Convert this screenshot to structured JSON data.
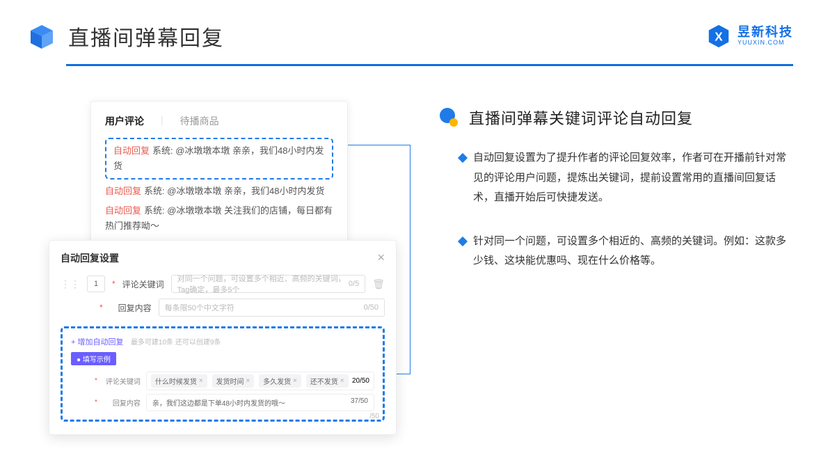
{
  "header": {
    "title": "直播间弹幕回复"
  },
  "brand": {
    "cn": "昱新科技",
    "en": "YUUXIN.COM"
  },
  "comments_card": {
    "tabs": {
      "active": "用户评论",
      "inactive": "待播商品"
    },
    "items": [
      {
        "prefix": "自动回复",
        "body": "系统: @冰墩墩本墩 亲亲，我们48小时内发货"
      },
      {
        "prefix": "自动回复",
        "body": "系统: @冰墩墩本墩 亲亲，我们48小时内发货"
      },
      {
        "prefix": "自动回复",
        "body": "系统: @冰墩墩本墩 关注我们的店铺，每日都有热门推荐呦～"
      }
    ]
  },
  "modal": {
    "title": "自动回复设置",
    "index": "1",
    "keyword_label": "评论关键词",
    "keyword_placeholder": "对同一个问题，可设置多个相近、高频的关键词，Tag确定，最多5个",
    "keyword_count": "0/5",
    "content_label": "回复内容",
    "content_placeholder": "每条限50个中文字符",
    "content_count": "0/50",
    "add_link": "+ 增加自动回复",
    "add_hint": "最多可建10条 还可以创建9条",
    "example_badge": "● 填写示例",
    "ex_keyword_label": "评论关键词",
    "ex_tags": [
      "什么时候发货",
      "发货时间",
      "多久发货",
      "还不发货"
    ],
    "ex_tag_count": "20/50",
    "ex_content_label": "回复内容",
    "ex_content_text": "亲，我们这边都是下单48小时内发货的哦～",
    "ex_content_count": "37/50",
    "stray": "/50"
  },
  "right": {
    "section_title": "直播间弹幕关键词评论自动回复",
    "bullets": [
      "自动回复设置为了提升作者的评论回复效率，作者可在开播前针对常见的评论用户问题，提炼出关键词，提前设置常用的直播间回复话术，直播开始后可快捷发送。",
      "针对同一个问题，可设置多个相近的、高频的关键词。例如：这款多少钱、这块能优惠吗、现在什么价格等。"
    ]
  }
}
